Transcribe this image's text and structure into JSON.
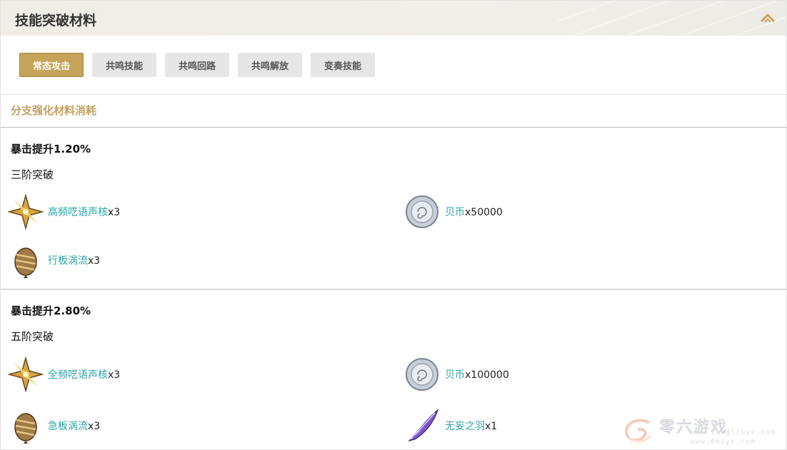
{
  "header": {
    "title": "技能突破材料"
  },
  "tabs": [
    {
      "label": "常态攻击",
      "active": true
    },
    {
      "label": "共鸣技能",
      "active": false
    },
    {
      "label": "共鸣回路",
      "active": false
    },
    {
      "label": "共鸣解放",
      "active": false
    },
    {
      "label": "变奏技能",
      "active": false
    }
  ],
  "section": {
    "title": "分支强化材料消耗"
  },
  "groups": [
    {
      "stat": "暴击提升1.20%",
      "stage": "三阶突破",
      "items": [
        {
          "name": "高频呓语声核",
          "qty": "x3",
          "icon": "star-core-icon"
        },
        {
          "name": "贝币",
          "qty": "x50000",
          "icon": "shell-coin-icon"
        },
        {
          "name": "行板涡流",
          "qty": "x3",
          "icon": "spiral-shell-icon"
        }
      ]
    },
    {
      "stat": "暴击提升2.80%",
      "stage": "五阶突破",
      "items": [
        {
          "name": "全频呓语声核",
          "qty": "x3",
          "icon": "star-core-icon"
        },
        {
          "name": "贝币",
          "qty": "x100000",
          "icon": "shell-coin-icon"
        },
        {
          "name": "急板涡流",
          "qty": "x3",
          "icon": "spiral-shell-icon"
        },
        {
          "name": "无妄之羽",
          "qty": "x1",
          "icon": "feather-icon"
        }
      ]
    }
  ],
  "watermark": {
    "text": "零六游戏",
    "url1": "www.lingliuyx.com",
    "url2": "www.06zyx.com"
  },
  "colors": {
    "accent": "#c6a35a",
    "link": "#2aa4a7",
    "section": "#c2a262"
  }
}
